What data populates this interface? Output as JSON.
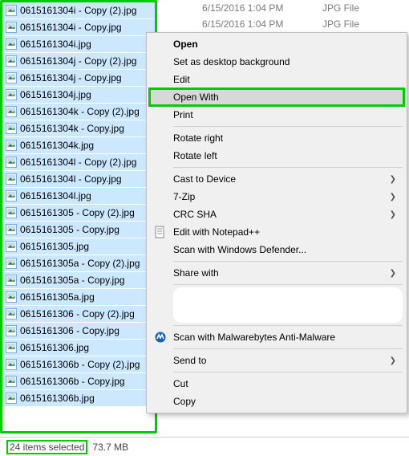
{
  "files": [
    "0615161304i - Copy (2).jpg",
    "0615161304i - Copy.jpg",
    "0615161304i.jpg",
    "0615161304j - Copy (2).jpg",
    "0615161304j - Copy.jpg",
    "0615161304j.jpg",
    "0615161304k - Copy (2).jpg",
    "0615161304k - Copy.jpg",
    "0615161304k.jpg",
    "0615161304l - Copy (2).jpg",
    "0615161304l - Copy.jpg",
    "0615161304l.jpg",
    "0615161305 - Copy (2).jpg",
    "0615161305 - Copy.jpg",
    "0615161305.jpg",
    "0615161305a - Copy (2).jpg",
    "0615161305a - Copy.jpg",
    "0615161305a.jpg",
    "0615161306 - Copy (2).jpg",
    "0615161306 - Copy.jpg",
    "0615161306.jpg",
    "0615161306b - Copy (2).jpg",
    "0615161306b - Copy.jpg",
    "0615161306b.jpg"
  ],
  "faded_rows": [
    {
      "date": "6/15/2016 1:04 PM",
      "type": "JPG File"
    },
    {
      "date": "6/15/2016 1:04 PM",
      "type": "JPG File"
    }
  ],
  "menu": [
    {
      "kind": "item",
      "label": "Open",
      "bold": true
    },
    {
      "kind": "item",
      "label": "Set as desktop background"
    },
    {
      "kind": "item",
      "label": "Edit"
    },
    {
      "kind": "item",
      "label": "Open With",
      "hover": true,
      "highlight": true
    },
    {
      "kind": "item",
      "label": "Print"
    },
    {
      "kind": "sep"
    },
    {
      "kind": "item",
      "label": "Rotate right"
    },
    {
      "kind": "item",
      "label": "Rotate left"
    },
    {
      "kind": "sep"
    },
    {
      "kind": "item",
      "label": "Cast to Device",
      "submenu": true
    },
    {
      "kind": "item",
      "label": "7-Zip",
      "submenu": true
    },
    {
      "kind": "item",
      "label": "CRC SHA",
      "submenu": true
    },
    {
      "kind": "item",
      "label": "Edit with Notepad++",
      "icon": "notepad-icon"
    },
    {
      "kind": "item",
      "label": "Scan with Windows Defender..."
    },
    {
      "kind": "sep"
    },
    {
      "kind": "item",
      "label": "Share with",
      "submenu": true
    },
    {
      "kind": "sep"
    },
    {
      "kind": "blank"
    },
    {
      "kind": "sep"
    },
    {
      "kind": "item",
      "label": "Scan with Malwarebytes Anti-Malware",
      "icon": "malwarebytes-icon"
    },
    {
      "kind": "sep"
    },
    {
      "kind": "item",
      "label": "Send to",
      "submenu": true
    },
    {
      "kind": "sep"
    },
    {
      "kind": "item",
      "label": "Cut"
    },
    {
      "kind": "item",
      "label": "Copy"
    }
  ],
  "status": {
    "selected": "24 items selected",
    "size": "73.7 MB"
  }
}
